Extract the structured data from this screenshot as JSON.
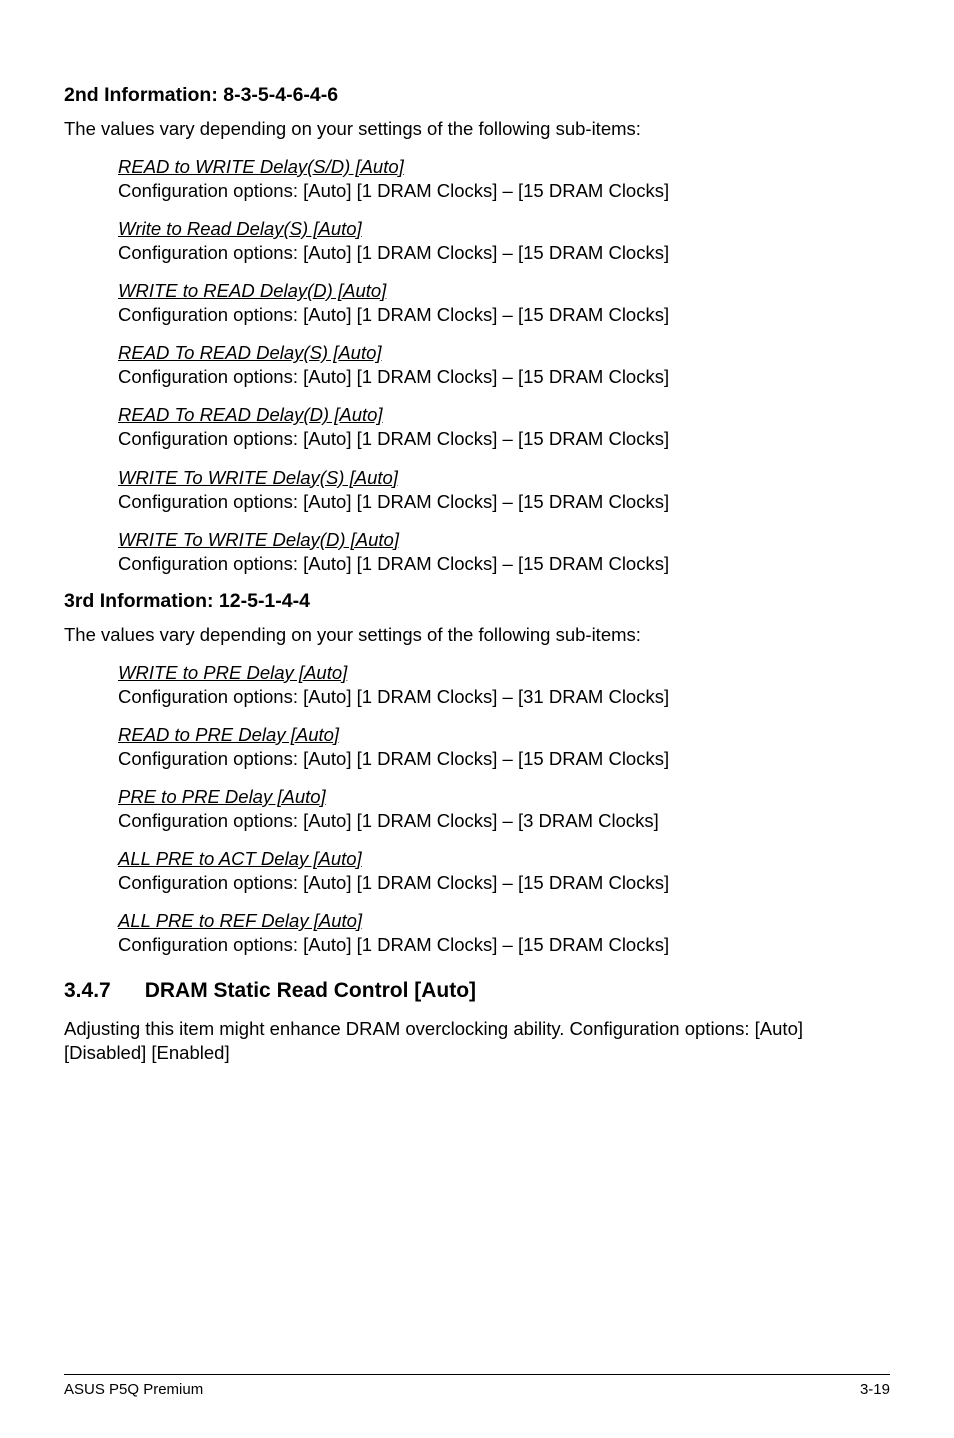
{
  "section2": {
    "heading": "2nd Information: 8-3-5-4-6-4-6",
    "intro": "The values vary depending on your settings of the following sub-items:",
    "items": [
      {
        "title": "READ to WRITE Delay(S/D) [Auto]",
        "desc": "Configuration options: [Auto] [1 DRAM Clocks] – [15 DRAM Clocks]"
      },
      {
        "title": "Write to Read Delay(S) [Auto]",
        "desc": "Configuration options: [Auto] [1 DRAM Clocks] – [15 DRAM Clocks]"
      },
      {
        "title": "WRITE to READ Delay(D) [Auto]",
        "desc": "Configuration options: [Auto] [1 DRAM Clocks] – [15 DRAM Clocks]"
      },
      {
        "title": "READ To READ Delay(S) [Auto]",
        "desc": "Configuration options: [Auto] [1 DRAM Clocks] – [15 DRAM Clocks]"
      },
      {
        "title": "READ To READ Delay(D) [Auto]",
        "desc": "Configuration options: [Auto] [1 DRAM Clocks] – [15 DRAM Clocks]"
      },
      {
        "title": "WRITE To WRITE Delay(S) [Auto]",
        "desc": "Configuration options: [Auto] [1 DRAM Clocks] – [15 DRAM Clocks]"
      },
      {
        "title": "WRITE To WRITE Delay(D) [Auto]",
        "desc": "Configuration options: [Auto] [1 DRAM Clocks] – [15 DRAM Clocks]"
      }
    ]
  },
  "section3": {
    "heading": "3rd Information: 12-5-1-4-4",
    "intro": "The values vary depending on your settings of the following sub-items:",
    "items": [
      {
        "title": "WRITE to PRE Delay [Auto]",
        "desc": "Configuration options: [Auto] [1 DRAM Clocks] – [31 DRAM Clocks]"
      },
      {
        "title": "READ to PRE Delay [Auto]",
        "desc": "Configuration options: [Auto] [1 DRAM Clocks] – [15 DRAM Clocks]"
      },
      {
        "title": "PRE to PRE Delay [Auto]",
        "desc": "Configuration options: [Auto] [1 DRAM Clocks] – [3 DRAM Clocks]"
      },
      {
        "title": "ALL PRE to ACT Delay [Auto]",
        "desc": "Configuration options: [Auto] [1 DRAM Clocks] – [15 DRAM Clocks]"
      },
      {
        "title": "ALL PRE to REF Delay [Auto]",
        "desc": "Configuration options: [Auto] [1 DRAM Clocks] – [15 DRAM Clocks]"
      }
    ]
  },
  "section347": {
    "num": "3.4.7",
    "title": "DRAM Static Read Control [Auto]",
    "desc": "Adjusting this item might enhance DRAM overclocking ability. Configuration options: [Auto] [Disabled] [Enabled]"
  },
  "footer": {
    "left": "ASUS P5Q Premium",
    "right": "3-19"
  }
}
